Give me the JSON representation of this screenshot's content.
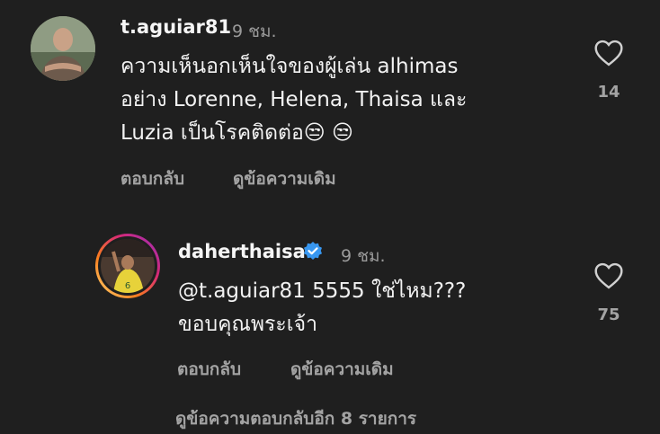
{
  "comments": [
    {
      "username": "t.aguiar81",
      "time": "9 ชม.",
      "lines": [
        "ความเห็นอกเห็นใจของผู้เล่น alhimas",
        "อย่าง Lorenne, Helena, Thaisa และ",
        "Luzia เป็นโรคติดต่อ😒 😒"
      ],
      "reply_label": "ตอบกลับ",
      "translate_label": "ดูข้อความเดิม",
      "likes": "14"
    },
    {
      "username": "daherthaisa",
      "verified": true,
      "time": "9 ชม.",
      "lines": [
        "@t.aguiar81 5555 ใช่ไหม???",
        "ขอบคุณพระเจ้า"
      ],
      "reply_label": "ตอบกลับ",
      "translate_label": "ดูข้อความเดิม",
      "likes": "75"
    }
  ],
  "view_more_replies": "ดูข้อความตอบกลับอีก 8 รายการ",
  "icons": {
    "like": "heart-outline-icon",
    "verified": "verified-badge-icon"
  },
  "colors": {
    "background": "#1f1f1f",
    "verified": "#3897f0",
    "story_ring": "#d62976"
  }
}
